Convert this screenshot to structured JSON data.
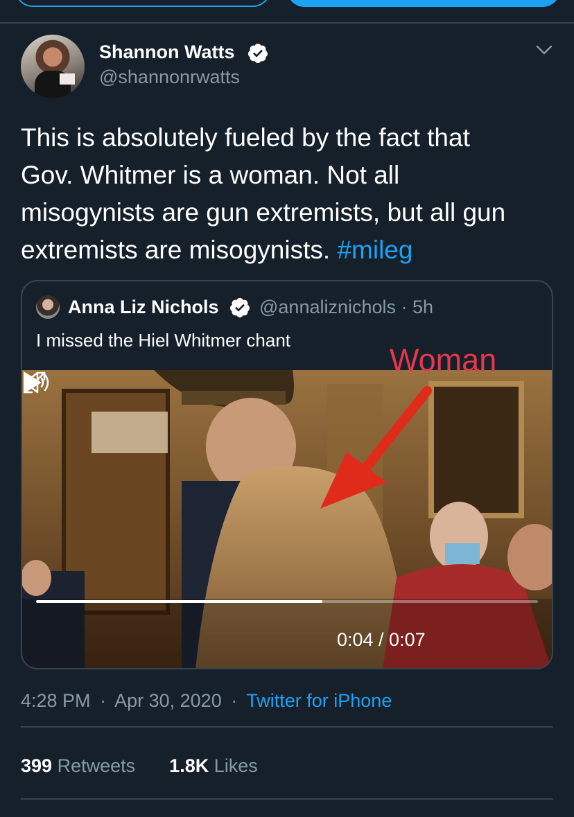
{
  "tweet": {
    "author_name": "Shannon Watts",
    "author_handle": "@shannonrwatts",
    "text_lines": [
      "This is absolutely fueled by the fact that",
      "Gov. Whitmer is a woman. Not all",
      "misogynists are gun extremists, but all gun",
      "extremists are misogynists."
    ],
    "hashtag": "#mileg",
    "time": "4:28 PM",
    "date": "Apr 30, 2020",
    "separator": "·",
    "source": "Twitter for iPhone",
    "stats": {
      "retweets_count": "399",
      "retweets_label": "Retweets",
      "likes_count": "1.8K",
      "likes_label": "Likes"
    }
  },
  "quoted_tweet": {
    "author_name": "Anna Liz Nichols",
    "author_handle": "@annaliznichols · 5h",
    "text": "I missed the Hiel Whitmer chant",
    "video": {
      "time_display": "0:04 / 0:07",
      "progress": 0.57
    }
  },
  "annotation": {
    "label": "Woman",
    "color": "#e8364d"
  },
  "colors": {
    "background": "#15202b",
    "accent": "#1da1f2",
    "secondary_text": "#8899a6",
    "border": "#38444d"
  }
}
